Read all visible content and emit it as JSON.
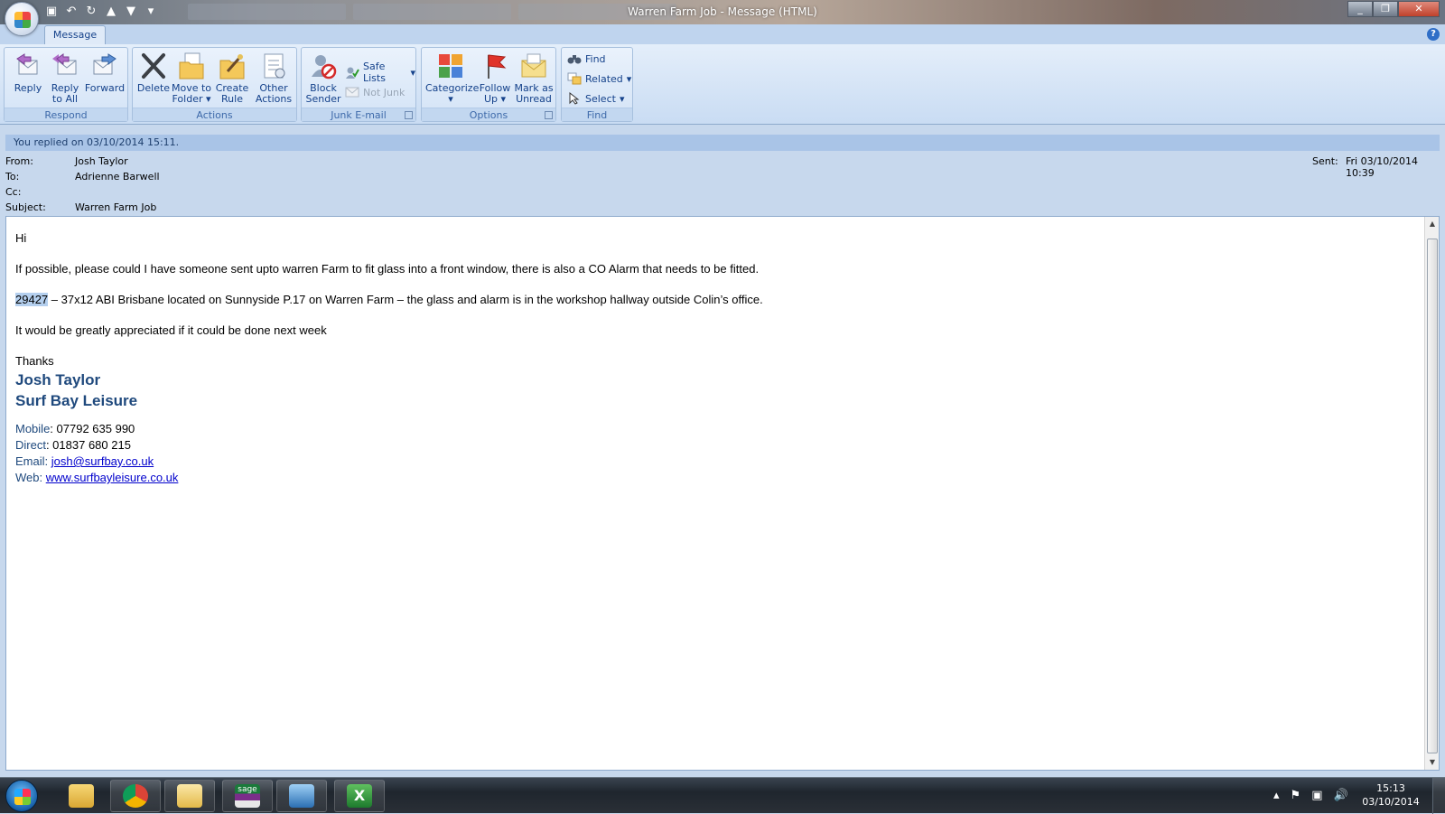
{
  "window": {
    "title": "Warren Farm Job - Message (HTML)",
    "minimize": "_",
    "maximize": "❐",
    "close": "✕"
  },
  "ribbon": {
    "tab": "Message",
    "groups": {
      "respond": {
        "label": "Respond",
        "reply": "Reply",
        "reply_all_1": "Reply",
        "reply_all_2": "to All",
        "forward": "Forward"
      },
      "actions": {
        "label": "Actions",
        "delete": "Delete",
        "move_1": "Move to",
        "move_2": "Folder",
        "rule_1": "Create",
        "rule_2": "Rule",
        "other_1": "Other",
        "other_2": "Actions"
      },
      "junk": {
        "label": "Junk E-mail",
        "block_1": "Block",
        "block_2": "Sender",
        "safe_lists": "Safe Lists",
        "not_junk": "Not Junk"
      },
      "options": {
        "label": "Options",
        "categorize": "Categorize",
        "follow_1": "Follow",
        "follow_2": "Up",
        "mark_1": "Mark as",
        "mark_2": "Unread"
      },
      "find": {
        "label": "Find",
        "find": "Find",
        "related": "Related",
        "select": "Select"
      }
    }
  },
  "info_bar": "You replied on 03/10/2014 15:11.",
  "header": {
    "from_label": "From:",
    "from": "Josh Taylor",
    "to_label": "To:",
    "to": "Adrienne Barwell",
    "cc_label": "Cc:",
    "cc": "",
    "subject_label": "Subject:",
    "subject": "Warren Farm Job",
    "sent_label": "Sent:",
    "sent": "Fri 03/10/2014 10:39"
  },
  "body": {
    "greeting": "Hi",
    "para1": "If possible, please could I have someone sent upto warren Farm to fit glass into a front window, there is also a CO Alarm that needs to be fitted.",
    "ref": "29427",
    "para2_rest": " – 37x12 ABI Brisbane located on Sunnyside P.17 on Warren Farm – the glass and alarm is in the workshop hallway outside Colin’s office.",
    "para3": "It would be greatly appreciated if it could be done next week",
    "thanks": "Thanks",
    "sig_name": "Josh Taylor",
    "sig_company": "Surf Bay Leisure",
    "mobile_label": "Mobile",
    "mobile": ": 07792 635 990",
    "direct_label": "Direct",
    "direct": ":  01837 680 215",
    "email_label": "Email: ",
    "email": "josh@surfbay.co.uk",
    "web_label": "Web: ",
    "web": "www.surfbayleisure.co.uk"
  },
  "taskbar": {
    "clock_time": "15:13",
    "clock_date": "03/10/2014",
    "sage_label": "sage"
  }
}
